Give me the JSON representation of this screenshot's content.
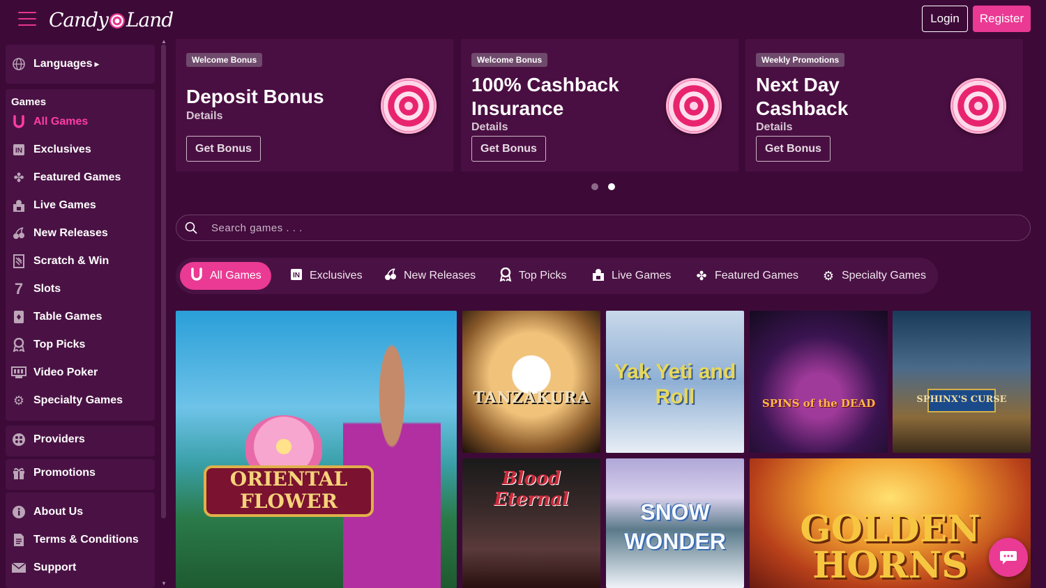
{
  "header": {
    "logo_text_1": "Candy",
    "logo_text_2": "Land",
    "login_label": "Login",
    "register_label": "Register"
  },
  "colors": {
    "accent": "#ea3a93",
    "background": "#3d0a38",
    "panel": "#4a1244"
  },
  "sidebar": {
    "languages_label": "Languages",
    "games_heading": "Games",
    "games": [
      {
        "label": "All Games",
        "icon": "horseshoe-icon",
        "active": true
      },
      {
        "label": "Exclusives",
        "icon": "in-badge-icon"
      },
      {
        "label": "Featured Games",
        "icon": "clover-icon"
      },
      {
        "label": "Live Games",
        "icon": "live-dealer-icon"
      },
      {
        "label": "New Releases",
        "icon": "cherries-icon"
      },
      {
        "label": "Scratch & Win",
        "icon": "scratch-card-icon"
      },
      {
        "label": "Slots",
        "icon": "seven-icon"
      },
      {
        "label": "Table Games",
        "icon": "card-icon"
      },
      {
        "label": "Top Picks",
        "icon": "award-icon"
      },
      {
        "label": "Video Poker",
        "icon": "video-poker-icon"
      },
      {
        "label": "Specialty Games",
        "icon": "gear-icon"
      }
    ],
    "providers_label": "Providers",
    "promotions_label": "Promotions",
    "about_label": "About Us",
    "terms_label": "Terms & Conditions",
    "support_label": "Support"
  },
  "promos": [
    {
      "badge": "Welcome Bonus",
      "title": "Deposit Bonus",
      "details": "Details",
      "button": "Get Bonus"
    },
    {
      "badge": "Welcome Bonus",
      "title": "100% Cashback Insurance",
      "details": "Details",
      "button": "Get Bonus"
    },
    {
      "badge": "Weekly Promotions",
      "title": "Next Day Cashback",
      "details": "Details",
      "button": "Get Bonus"
    }
  ],
  "carousel": {
    "pages": 2,
    "active_page": 2
  },
  "search": {
    "placeholder": "Search games . . ."
  },
  "tabs": [
    {
      "label": "All Games",
      "icon": "horseshoe-icon",
      "active": true
    },
    {
      "label": "Exclusives",
      "icon": "in-badge-icon"
    },
    {
      "label": "New Releases",
      "icon": "cherries-icon"
    },
    {
      "label": "Top Picks",
      "icon": "award-icon"
    },
    {
      "label": "Live Games",
      "icon": "live-dealer-icon"
    },
    {
      "label": "Featured Games",
      "icon": "clover-icon"
    },
    {
      "label": "Specialty Games",
      "icon": "gear-icon"
    }
  ],
  "games": [
    {
      "title": "ORIENTAL FLOWER"
    },
    {
      "title": "TANZAKURA"
    },
    {
      "title": "Yak Yeti and Roll"
    },
    {
      "title": "SPINS of the DEAD"
    },
    {
      "title": "SPHINX'S CURSE"
    },
    {
      "title": "Blood Eternal"
    },
    {
      "title": "SNOW WONDER"
    },
    {
      "title": "GOLDEN HORNS"
    }
  ]
}
